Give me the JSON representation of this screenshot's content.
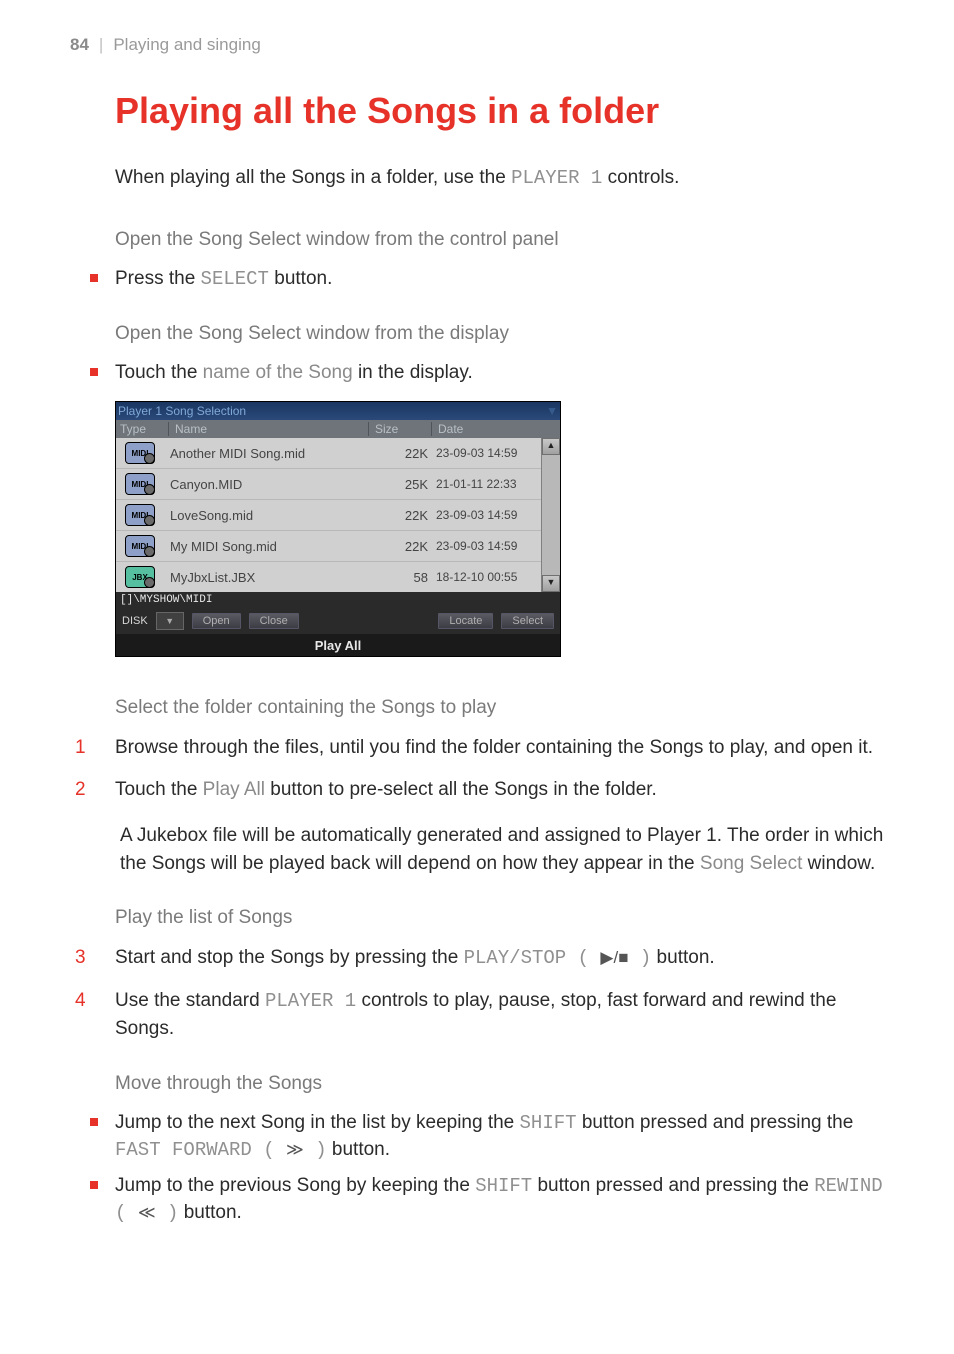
{
  "header": {
    "page_num": "84",
    "separator": "|",
    "section": "Playing and singing"
  },
  "title": "Playing all the Songs in a folder",
  "intro": {
    "pre": "When playing all the Songs in a folder, use the ",
    "mono": "PLAYER 1",
    "post": " controls."
  },
  "sect1": "Open the Song Select window from the control panel",
  "bullet1": {
    "pre": "Press the ",
    "mono": "SELECT",
    "post": " button."
  },
  "sect2": "Open the Song Select window from the display",
  "bullet2": {
    "pre": "Touch the ",
    "mono": "name of the Song",
    "post": " in the display."
  },
  "screenshot": {
    "title": "Player 1 Song Selection",
    "columns": {
      "type": "Type",
      "name": "Name",
      "size": "Size",
      "date": "Date"
    },
    "rows": [
      {
        "icon": "MIDI",
        "name": "Another MIDI Song.mid",
        "size": "22K",
        "date": "23-09-03 14:59"
      },
      {
        "icon": "MIDI",
        "name": "Canyon.MID",
        "size": "25K",
        "date": "21-01-11 22:33"
      },
      {
        "icon": "MIDI",
        "name": "LoveSong.mid",
        "size": "22K",
        "date": "23-09-03 14:59"
      },
      {
        "icon": "MIDI",
        "name": "My MIDI Song.mid",
        "size": "22K",
        "date": "23-09-03 14:59"
      },
      {
        "icon": "JBX",
        "name": "MyJbxList.JBX",
        "size": "58",
        "date": "18-12-10 00:55"
      }
    ],
    "path": "[]\\MYSHOW\\MIDI",
    "disk_label": "DISK",
    "buttons": {
      "open": "Open",
      "close": "Close",
      "locate": "Locate",
      "select": "Select"
    },
    "playall": "Play All"
  },
  "sect3": "Select the folder containing the Songs to play",
  "step1": {
    "num": "1",
    "text": "Browse through the files, until you find the folder containing the Songs to play, and open it."
  },
  "step2": {
    "num": "2",
    "pre": "Touch the ",
    "mono": "Play All",
    "post": " button to pre-select all the Songs in the folder."
  },
  "step2_extra": {
    "pre": "A Jukebox file will be automatically generated and assigned to Player 1. The order in which the Songs will be played back will depend on how they appear in the ",
    "mono": "Song Select",
    "post": " window."
  },
  "sect4": "Play the list of Songs",
  "step3": {
    "num": "3",
    "pre": "Start and stop the Songs by pressing the ",
    "mono": "PLAY/STOP ( ",
    "icon": "▶/■",
    "mono2": " )",
    "post": " button."
  },
  "step4": {
    "num": "4",
    "pre": "Use the standard ",
    "mono": "PLAYER 1",
    "post": " controls to play, pause, stop, fast forward and rewind the Songs."
  },
  "sect5": "Move through the Songs",
  "bullet3": {
    "pre": "Jump to the next Song in the list by keeping the ",
    "mono": "SHIFT",
    "mid": " button pressed and pressing the ",
    "mono2": "FAST FORWARD ( ",
    "icon": "≫",
    "mono3": " )",
    "post": " button."
  },
  "bullet4": {
    "pre": "Jump to the previous Song by keeping the ",
    "mono": "SHIFT",
    "mid": " button pressed and pressing the ",
    "mono2": "REWIND ( ",
    "icon": "≪",
    "mono3": " )",
    "post": " button."
  }
}
